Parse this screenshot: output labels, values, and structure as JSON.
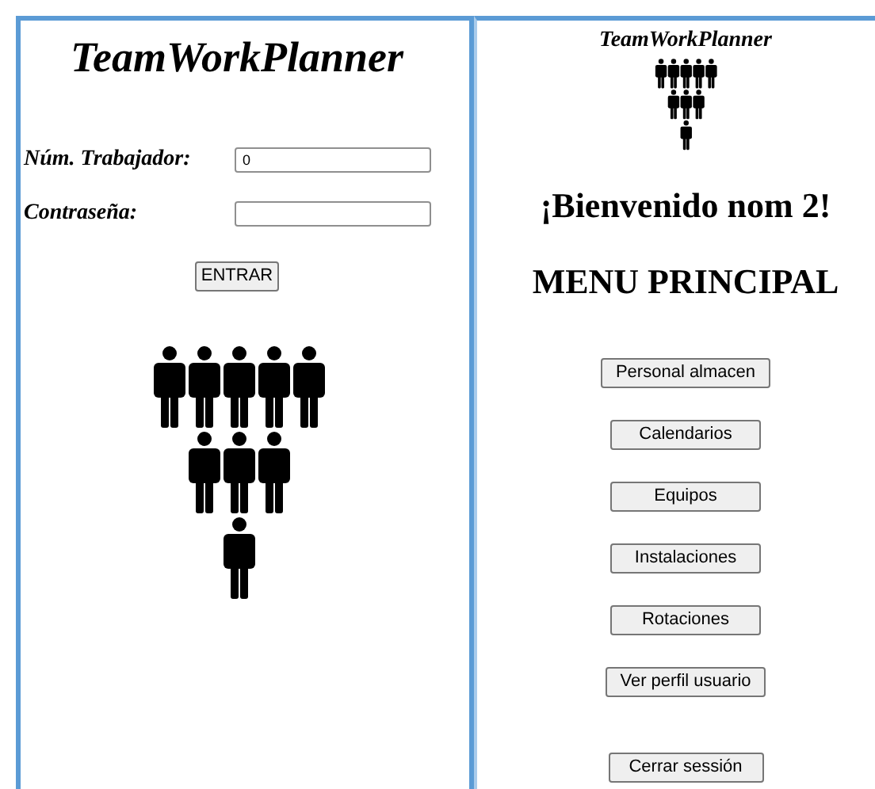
{
  "login": {
    "title": "TeamWorkPlanner",
    "fields": [
      {
        "label": "Núm. Trabajador:",
        "value": "0"
      },
      {
        "label": "Contraseña:"
      }
    ],
    "button": "ENTRAR"
  },
  "menu": {
    "title": "TeamWorkPlanner",
    "welcome": "¡Bienvenido nom 2!",
    "heading": "MENU PRINCIPAL",
    "buttons": [
      "Personal almacen",
      "Calendarios",
      "Equipos",
      "Instalaciones",
      "Rotaciones",
      "Ver perfil usuario"
    ],
    "logout": "Cerrar sessión"
  }
}
